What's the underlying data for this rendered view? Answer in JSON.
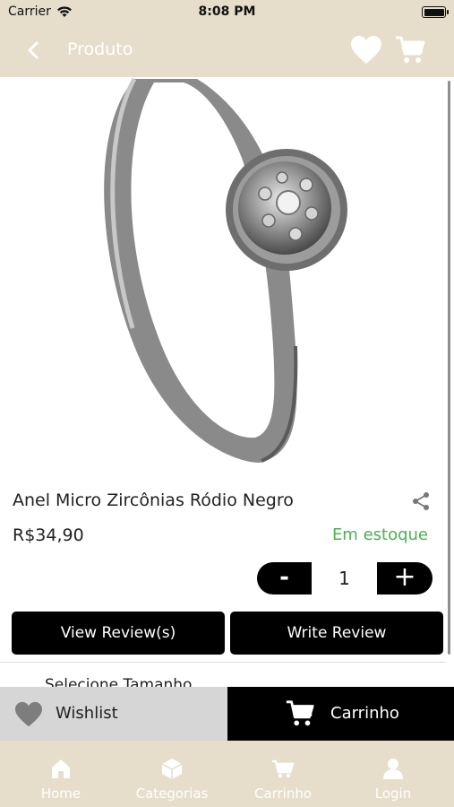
{
  "status_bar": {
    "carrier": "Carrier",
    "time": "8:08 PM",
    "icons": [
      "wifi-icon",
      "battery-icon"
    ]
  },
  "nav_bar": {
    "title": "Produto",
    "icons": [
      "back-arrow-icon",
      "heart-icon",
      "cart-icon"
    ]
  },
  "product": {
    "image": "silver-ring-with-zircon-cluster",
    "name": "Anel Micro Zircônias Ródio Negro",
    "price": "R$34,90",
    "stock": "Em estoque",
    "share_icon": "share-icon"
  },
  "quantity": {
    "minus": "-",
    "value": "1",
    "plus": "+"
  },
  "reviews": {
    "view_label": "View Review(s)",
    "write_label": "Write Review"
  },
  "options": {
    "select_size": "Selecione Tamanho"
  },
  "action_bar": {
    "wishlist_label": "Wishlist",
    "cart_label": "Carrinho"
  },
  "tab_bar": {
    "tabs": [
      {
        "label": "Home",
        "icon": "home-icon"
      },
      {
        "label": "Categorias",
        "icon": "categories-icon"
      },
      {
        "label": "Carrinho",
        "icon": "cart-icon"
      },
      {
        "label": "Login",
        "icon": "user-icon"
      }
    ]
  },
  "colors": {
    "header_bg": "#e6decb",
    "accent_black": "#000000",
    "stock_green": "#4caf50",
    "wishlist_bg": "#d6d6d6"
  }
}
